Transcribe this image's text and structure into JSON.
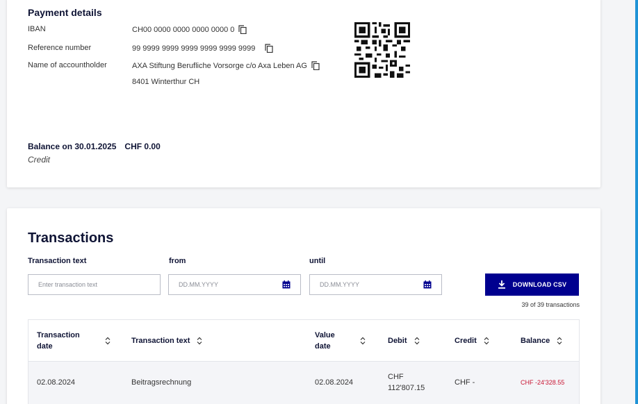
{
  "payment": {
    "title": "Payment details",
    "iban_label": "IBAN",
    "iban_value": "CH00 0000 0000 0000 0000 0",
    "reference_label": "Reference number",
    "reference_value": "99 9999 9999 9999 9999 9999 9999",
    "holder_label": "Name of accountholder",
    "holder_value": "AXA Stiftung Berufliche Vorsorge c/o Axa Leben AG",
    "holder_address": "8401 Winterthur CH",
    "balance_label": "Balance on 30.01.2025",
    "balance_value": "CHF 0.00",
    "balance_status": "Credit"
  },
  "transactions": {
    "title": "Transactions",
    "text_label": "Transaction text",
    "text_placeholder": "Enter transaction text",
    "from_label": "from",
    "from_placeholder": "DD.MM.YYYY",
    "until_label": "until",
    "until_placeholder": "DD.MM.YYYY",
    "download_label": "DOWNLOAD CSV",
    "count": "39 of 39 transactions",
    "columns": {
      "date": [
        "Transaction",
        "date"
      ],
      "text": "Transaction text",
      "value_date": [
        "Value",
        "date"
      ],
      "debit": "Debit",
      "credit": "Credit",
      "balance": "Balance"
    },
    "rows": [
      {
        "date": "02.08.2024",
        "text": "Beitragsrechnung",
        "value_date": "02.08.2024",
        "debit": [
          "CHF",
          "112'807.15"
        ],
        "credit": "CHF -",
        "balance": "CHF -24'328.55"
      }
    ]
  },
  "colors": {
    "primary": "#00008f",
    "negative": "#c91432",
    "heading": "#0f1435",
    "rail": "#1f93d6"
  }
}
